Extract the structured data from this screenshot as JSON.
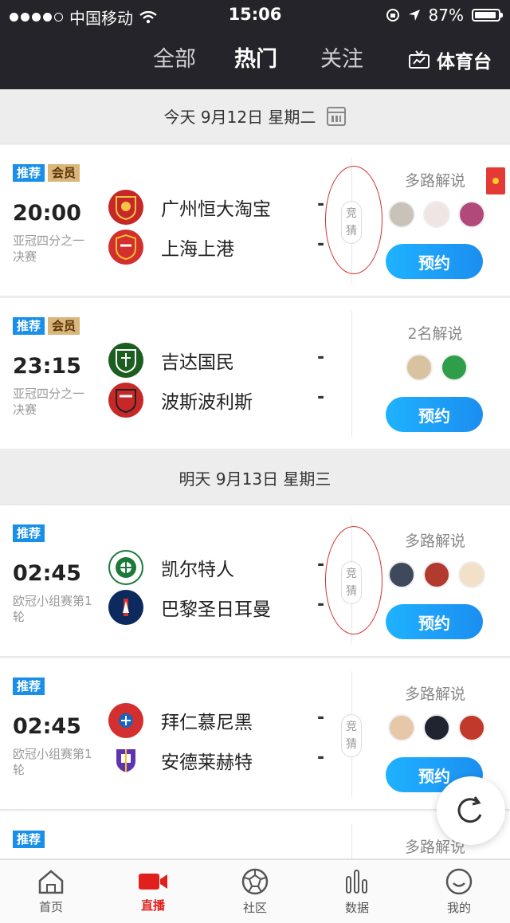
{
  "status_bar": {
    "carrier": "中国移动",
    "time": "15:06",
    "battery": "87%",
    "signal_bars": 4,
    "signal_total": 5
  },
  "nav_tabs": {
    "all": "全部",
    "hot": "热门",
    "follow": "关注",
    "sports_tv": "体育台",
    "active": "hot"
  },
  "sections": [
    {
      "date_label": "今天 9月12日 星期二",
      "matches": [
        {
          "badges": [
            "推荐",
            "会员"
          ],
          "time": "20:00",
          "competition": "亚冠四分之一决赛",
          "home": {
            "name": "广州恒大淘宝",
            "score": "-"
          },
          "away": {
            "name": "上海上港",
            "score": "-"
          },
          "guess_label": "竞猜",
          "commentary": "多路解说",
          "book_label": "预约"
        },
        {
          "badges": [
            "推荐",
            "会员"
          ],
          "time": "23:15",
          "competition": "亚冠四分之一决赛",
          "home": {
            "name": "吉达国民",
            "score": "-"
          },
          "away": {
            "name": "波斯波利斯",
            "score": "-"
          },
          "guess_label": "",
          "commentary": "2名解说",
          "book_label": "预约"
        }
      ]
    },
    {
      "date_label": "明天 9月13日 星期三",
      "matches": [
        {
          "badges": [
            "推荐"
          ],
          "time": "02:45",
          "competition": "欧冠小组赛第1轮",
          "home": {
            "name": "凯尔特人",
            "score": "-"
          },
          "away": {
            "name": "巴黎圣日耳曼",
            "score": "-"
          },
          "guess_label": "竞猜",
          "commentary": "多路解说",
          "book_label": "预约"
        },
        {
          "badges": [
            "推荐"
          ],
          "time": "02:45",
          "competition": "欧冠小组赛第1轮",
          "home": {
            "name": "拜仁慕尼黑",
            "score": "-"
          },
          "away": {
            "name": "安德莱赫特",
            "score": "-"
          },
          "guess_label": "竞猜",
          "commentary": "多路解说",
          "book_label": "预约"
        },
        {
          "badges": [
            "推荐"
          ],
          "commentary": "多路解说"
        }
      ]
    }
  ],
  "bottom_nav": {
    "home": "首页",
    "live": "直播",
    "community": "社区",
    "data": "数据",
    "mine": "我的",
    "active": "live"
  },
  "colors": {
    "accent_blue": "#1b8ef0",
    "live_red": "#e0201c",
    "topbar_bg": "#24242a"
  }
}
